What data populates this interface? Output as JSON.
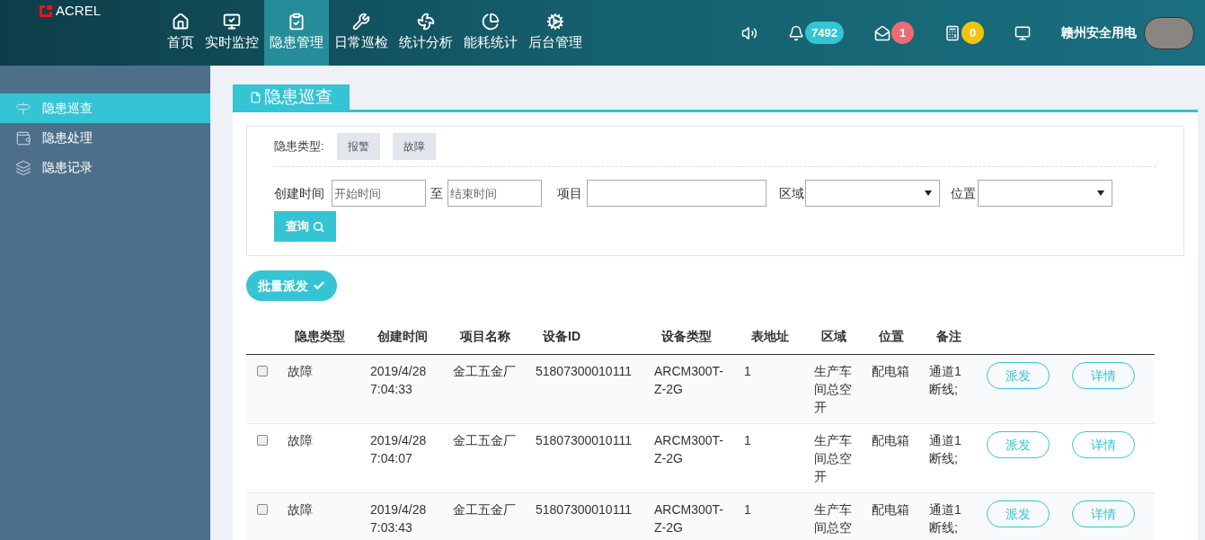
{
  "header": {
    "logo": "ACREL",
    "nav": [
      {
        "label": "首页",
        "kind": "home",
        "selected": false
      },
      {
        "label": "实时监控",
        "kind": "monitor",
        "selected": false
      },
      {
        "label": "隐患管理",
        "kind": "clipboard",
        "selected": true
      },
      {
        "label": "日常巡检",
        "kind": "tools",
        "selected": false
      },
      {
        "label": "统计分析",
        "kind": "pinwheel",
        "selected": false
      },
      {
        "label": "能耗统计",
        "kind": "pie",
        "selected": false
      },
      {
        "label": "后台管理",
        "kind": "gears",
        "selected": false
      }
    ],
    "alerts": [
      {
        "kind": "speaker"
      },
      {
        "kind": "bell",
        "count": "7492",
        "color": "#35c4d4"
      },
      {
        "kind": "mail",
        "count": "1",
        "color": "#ef6a74"
      },
      {
        "kind": "calculator",
        "count": "0",
        "color": "#f2c40f"
      },
      {
        "kind": "display"
      }
    ],
    "user": "赣州安全用电"
  },
  "sidebar": {
    "items": [
      {
        "label": "隐患巡查",
        "kind": "signpost",
        "selected": true
      },
      {
        "label": "隐患处理",
        "kind": "wallet",
        "selected": false
      },
      {
        "label": "隐患记录",
        "kind": "layers",
        "selected": false
      }
    ]
  },
  "page_title": "隐患巡查",
  "filter": {
    "type_label": "隐患类型:",
    "type_options": [
      "报警",
      "故障"
    ],
    "created_label": "创建时间",
    "start_placeholder": "开始时间",
    "to_label": "至",
    "end_placeholder": "结束时间",
    "project_label": "项目",
    "area_label": "区域",
    "location_label": "位置",
    "query_button": "查询"
  },
  "batch_button": "批量派发",
  "table": {
    "columns": [
      "隐患类型",
      "创建时间",
      "项目名称",
      "设备ID",
      "设备类型",
      "表地址",
      "区域",
      "位置",
      "备注"
    ],
    "rows": [
      {
        "checked": false,
        "cells": [
          "故障",
          "2019/4/28 7:04:33",
          "金工五金厂",
          "51807300010111",
          "ARCM300T-Z-2G",
          "1",
          "生产车间总空开",
          "配电箱",
          "通道1断线;"
        ],
        "actions": [
          "派发",
          "详情"
        ]
      },
      {
        "checked": false,
        "cells": [
          "故障",
          "2019/4/28 7:04:07",
          "金工五金厂",
          "51807300010111",
          "ARCM300T-Z-2G",
          "1",
          "生产车间总空开",
          "配电箱",
          "通道1断线;"
        ],
        "actions": [
          "派发",
          "详情"
        ]
      },
      {
        "checked": false,
        "cells": [
          "故障",
          "2019/4/28 7:03:43",
          "金工五金厂",
          "51807300010111",
          "ARCM300T-Z-2G",
          "1",
          "生产车间总空",
          "配电箱",
          "通道1断线;"
        ],
        "actions": [
          "派发",
          "详情"
        ]
      }
    ]
  }
}
